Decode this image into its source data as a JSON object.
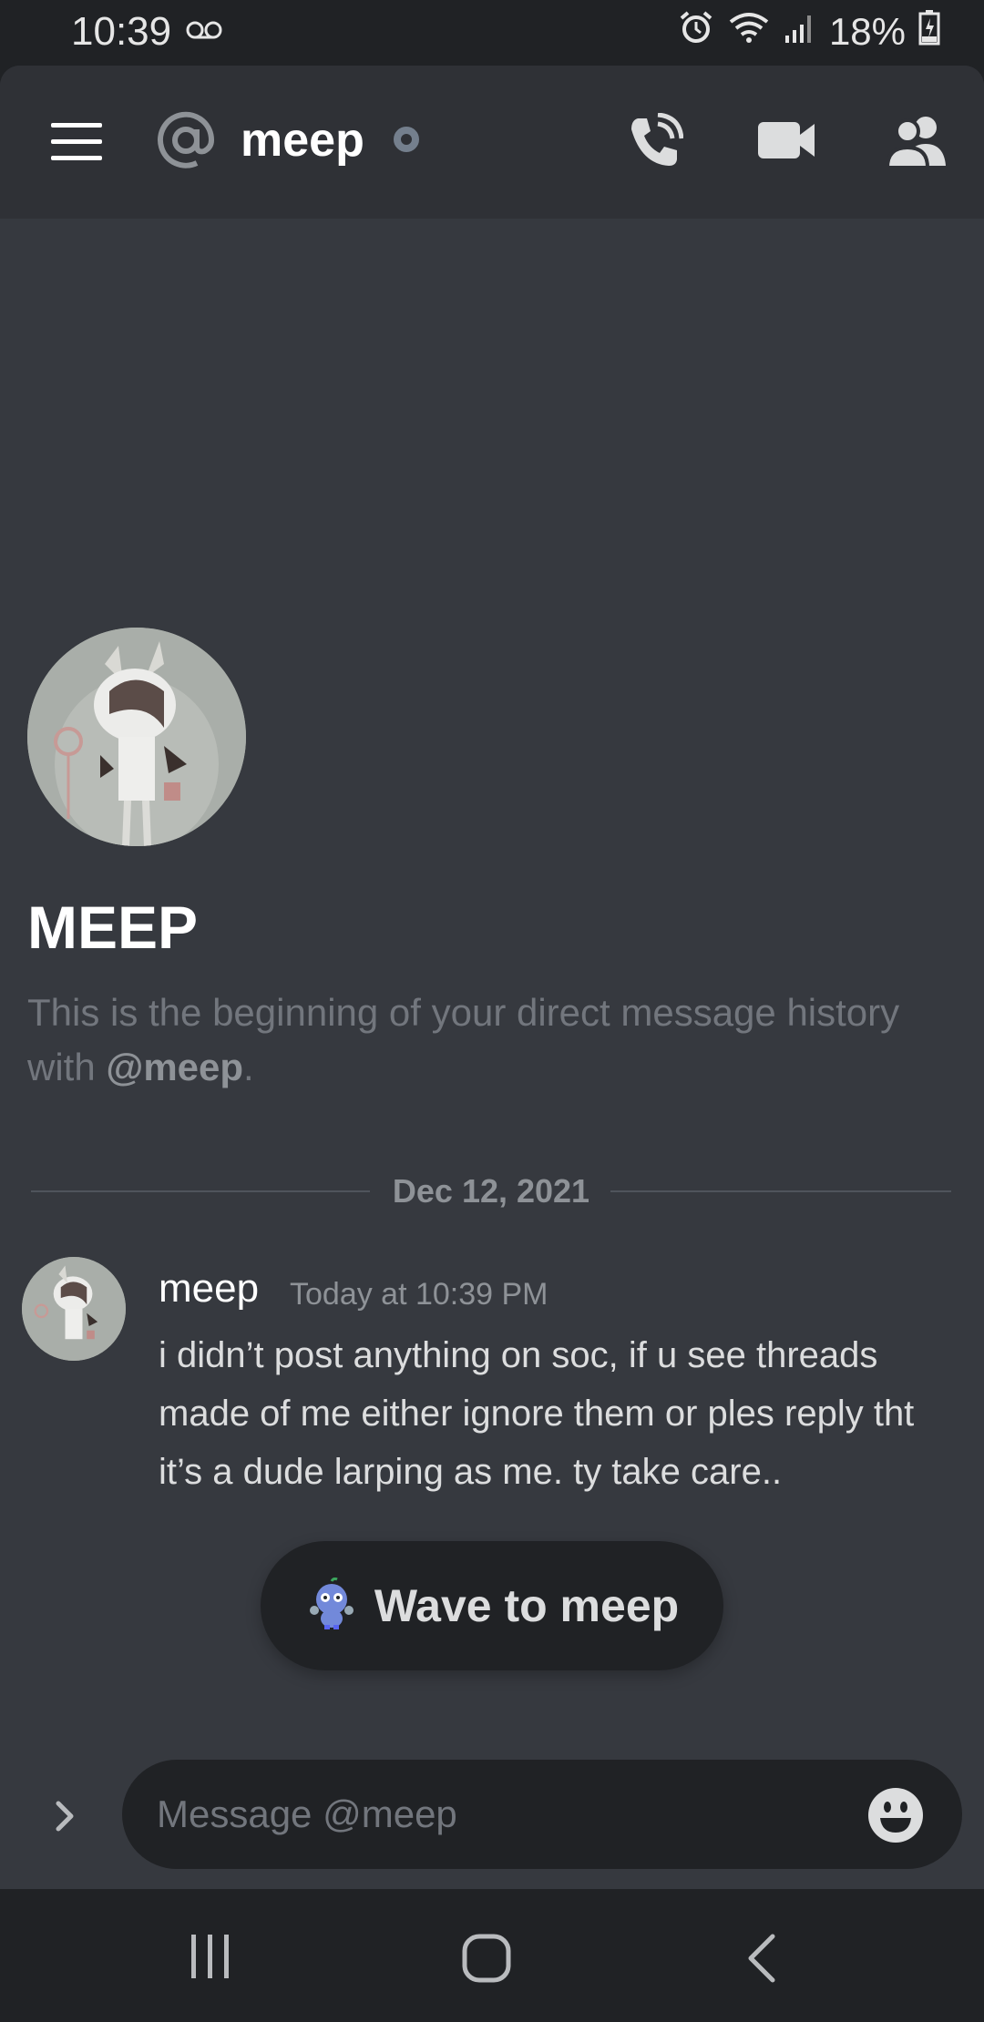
{
  "status_bar": {
    "time": "10:39",
    "battery": "18%"
  },
  "header": {
    "channel_name": "meep"
  },
  "profile": {
    "name": "MEEP",
    "intro_prefix": "This is the beginning of your direct message history with ",
    "intro_mention": "@meep",
    "intro_suffix": "."
  },
  "date_divider": "Dec 12, 2021",
  "message": {
    "author": "meep",
    "timestamp": "Today at 10:39 PM",
    "text": "i didn’t post anything on soc, if u see threads made of me either ignore them or ples reply tht it’s a dude larping as me. ty take care.."
  },
  "wave_button": {
    "label": "Wave to meep"
  },
  "composer": {
    "placeholder": "Message @meep"
  },
  "colors": {
    "background": "#36393f",
    "header": "#2f3136",
    "dark": "#202225",
    "muted_text": "#72767d",
    "status_offline": "#747f8d"
  }
}
